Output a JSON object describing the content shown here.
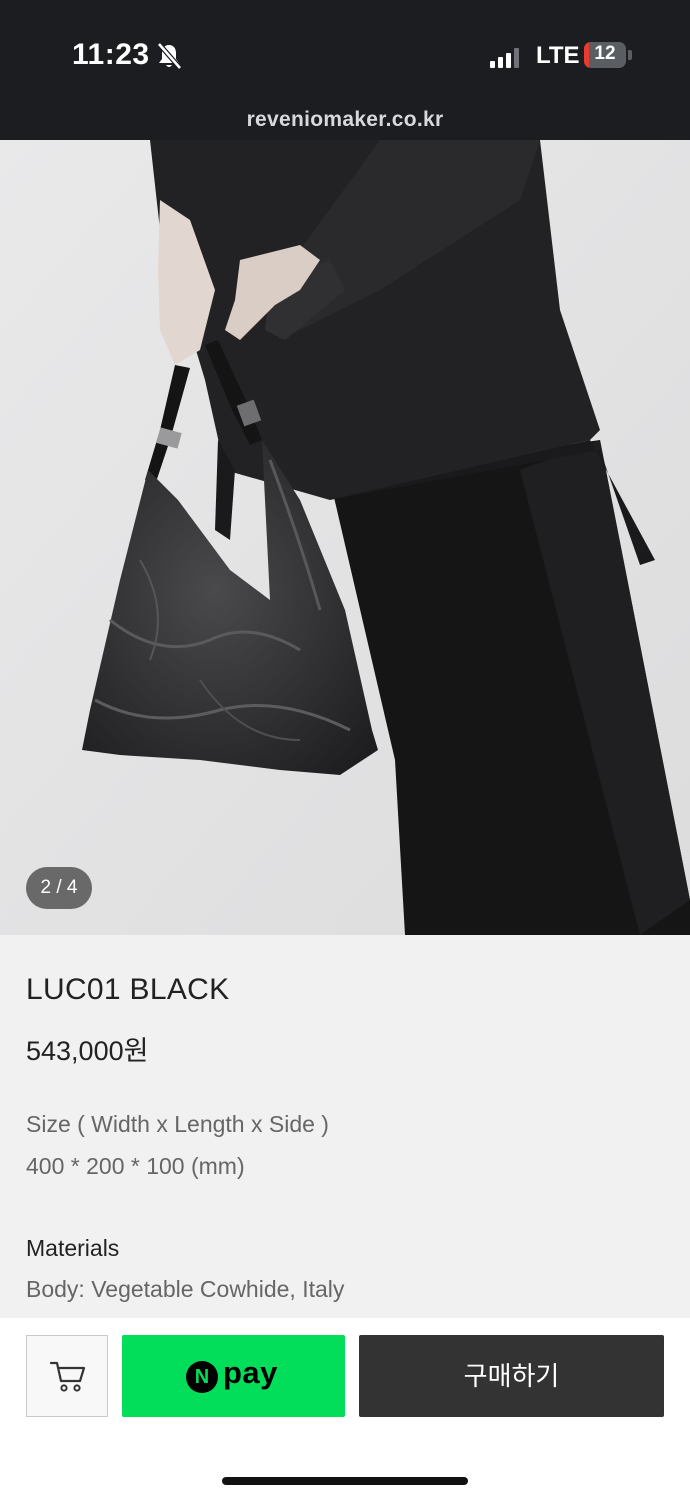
{
  "status_bar": {
    "time": "11:23",
    "network": "LTE",
    "battery_level": "12",
    "battery_fraction": 0.12,
    "icons": [
      "bell-slash-icon",
      "signal-bars-icon",
      "battery-icon"
    ]
  },
  "browser": {
    "url": "reveniomaker.co.kr"
  },
  "gallery": {
    "counter": "2 / 4"
  },
  "product": {
    "name": "LUC01 BLACK",
    "price": "543,000원",
    "size_label": "Size ( Width x  Length  x Side )",
    "size_value": "400 * 200 * 100 (mm)",
    "materials_label": "Materials",
    "materials_value": "Body: Vegetable Cowhide, Italy"
  },
  "actions": {
    "cart_icon": "cart-icon",
    "npay_n": "N",
    "npay_word": "pay",
    "buy_label": "구매하기"
  },
  "colors": {
    "npay_green": "#03de5a",
    "buy_button": "#333333",
    "topbar": "#1b1d20",
    "battery_low": "#ea3b2e"
  }
}
